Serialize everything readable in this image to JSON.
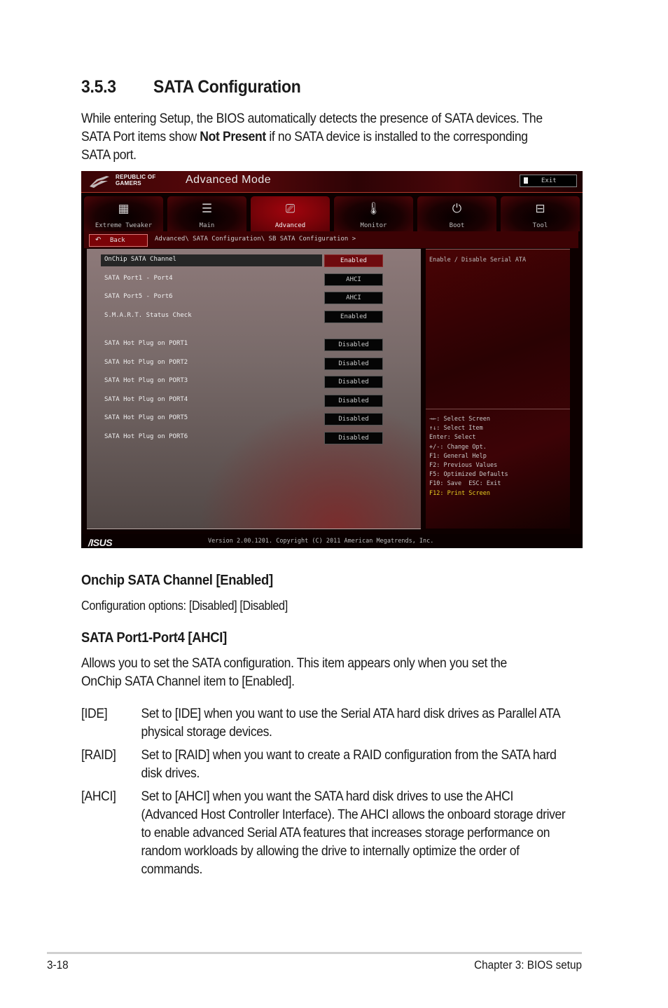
{
  "section": {
    "number": "3.5.3",
    "title": "SATA Configuration",
    "intro_part1": "While entering Setup, the BIOS automatically detects the presence of SATA devices. The SATA Port items show ",
    "intro_bold": "Not Present",
    "intro_part2": " if no SATA device is installed to the corresponding SATA port."
  },
  "bios": {
    "brand_line1": "REPUBLIC OF",
    "brand_line2": "GAMERS",
    "mode_title": "Advanced Mode",
    "exit_label": "Exit",
    "tabs": [
      {
        "label": "Extreme Tweaker",
        "icon": "cpu-cooler-icon",
        "glyph": "▦",
        "active": false
      },
      {
        "label": "Main",
        "icon": "list-icon",
        "glyph": "☰",
        "active": false
      },
      {
        "label": "Advanced",
        "icon": "advanced-info-icon",
        "glyph": "⎚",
        "active": true
      },
      {
        "label": "Monitor",
        "icon": "thermometer-icon",
        "glyph": "🌡",
        "active": false
      },
      {
        "label": "Boot",
        "icon": "power-icon",
        "glyph": "⏻",
        "active": false
      },
      {
        "label": "Tool",
        "icon": "toolbox-icon",
        "glyph": "⊟",
        "active": false
      }
    ],
    "back_label": "Back",
    "breadcrumb": "Advanced\\ SATA Configuration\\ SB SATA Configuration >",
    "settings": [
      {
        "label": "OnChip SATA Channel",
        "value": "Enabled",
        "selected": true
      },
      {
        "label": "SATA Port1 - Port4",
        "value": "AHCI",
        "selected": false
      },
      {
        "label": "SATA Port5 - Port6",
        "value": "AHCI",
        "selected": false
      },
      {
        "label": "S.M.A.R.T. Status Check",
        "value": "Enabled",
        "selected": false
      },
      {
        "label": "SATA Hot Plug on PORT1",
        "value": "Disabled",
        "selected": false
      },
      {
        "label": "SATA Hot Plug on PORT2",
        "value": "Disabled",
        "selected": false
      },
      {
        "label": "SATA Hot Plug on PORT3",
        "value": "Disabled",
        "selected": false
      },
      {
        "label": "SATA Hot Plug on PORT4",
        "value": "Disabled",
        "selected": false
      },
      {
        "label": "SATA Hot Plug on PORT5",
        "value": "Disabled",
        "selected": false
      },
      {
        "label": "SATA Hot Plug on PORT6",
        "value": "Disabled",
        "selected": false
      }
    ],
    "help_description": "Enable / Disable Serial ATA",
    "keys": [
      "→←: Select Screen",
      "↑↓: Select Item",
      "Enter: Select",
      "+/-: Change Opt.",
      "F1: General Help",
      "F2: Previous Values",
      "F5: Optimized Defaults",
      "F10: Save  ESC: Exit"
    ],
    "key_highlight": "F12: Print Screen",
    "asus_logo": "/ISUS",
    "version": "Version 2.00.1201. Copyright (C) 2011 American Megatrends, Inc."
  },
  "onchip": {
    "heading": "Onchip SATA Channel [Enabled]",
    "text": "Configuration options: [Disabled] [Disabled]"
  },
  "port14": {
    "heading": "SATA Port1-Port4 [AHCI]",
    "text": "Allows you to set the SATA configuration. This item appears only when you set the OnChip SATA Channel item to [Enabled].",
    "options": [
      {
        "key": "[IDE]",
        "desc": "Set to [IDE] when you want to use the Serial ATA hard disk drives as Parallel ATA physical storage devices."
      },
      {
        "key": "[RAID]",
        "desc": "Set to [RAID] when you want to create a RAID configuration from the SATA hard disk drives."
      },
      {
        "key": "[AHCI]",
        "desc": "Set to [AHCI] when you want the SATA hard disk drives to use the AHCI (Advanced Host Controller Interface). The AHCI allows the onboard storage driver to enable advanced Serial ATA features that increases storage performance on random workloads by allowing the drive to internally optimize the order of commands."
      }
    ]
  },
  "footer": {
    "page_number": "3-18",
    "chapter": "Chapter 3: BIOS setup"
  }
}
